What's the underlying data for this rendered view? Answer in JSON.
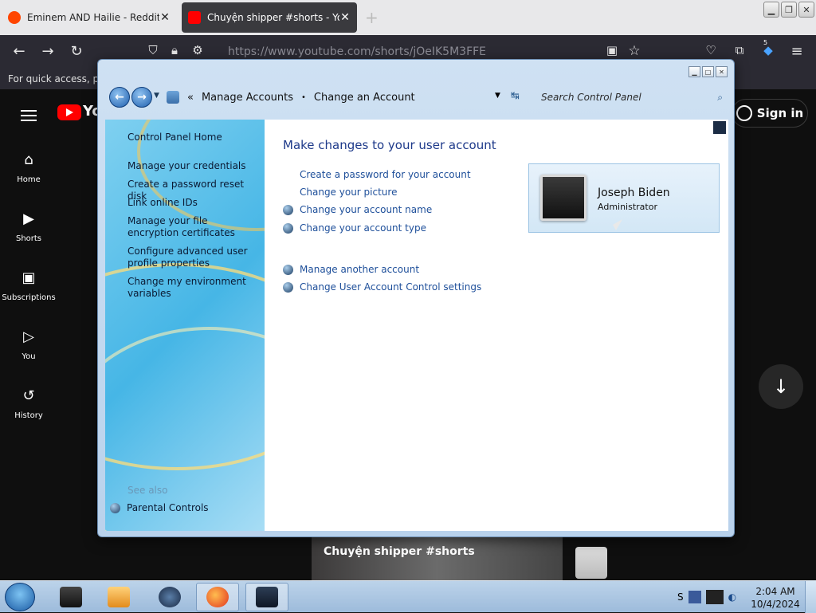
{
  "browser": {
    "tabs": [
      {
        "title": "Eminem AND Hailie - Reddit Se",
        "close": "✕"
      },
      {
        "title": "Chuyện shipper #shorts - YouTu",
        "close": "✕"
      }
    ],
    "new_tab": "+",
    "url": "https://www.youtube.com/shorts/jOeIK5M3FFE",
    "bookmarks_notice": "For quick access, plac",
    "extension_badge": "5"
  },
  "youtube": {
    "logo_text": "Yo",
    "sign_in": "Sign in",
    "nav": [
      {
        "label": "Home",
        "icon": "⌂"
      },
      {
        "label": "Shorts",
        "icon": "▶"
      },
      {
        "label": "Subscriptions",
        "icon": "▣"
      },
      {
        "label": "You",
        "icon": "▷"
      },
      {
        "label": "History",
        "icon": "↺"
      }
    ],
    "video_title": "Chuyện shipper #shorts",
    "scroll_down": "↓"
  },
  "control_panel": {
    "breadcrumb": {
      "prefix": "«",
      "item1": "Manage Accounts",
      "separator": "•",
      "item2": "Change an Account"
    },
    "search_placeholder": "Search Control Panel",
    "left_links": [
      "Control Panel Home",
      "Manage your credentials",
      "Create a password reset disk",
      "Link online IDs",
      "Manage your file encryption certificates",
      "Configure advanced user profile properties",
      "Change my environment variables"
    ],
    "see_also": "See also",
    "parental_controls": "Parental Controls",
    "main_title": "Make changes to your user account",
    "links": [
      "Create a password for your account",
      "Change your picture",
      "Change your account name",
      "Change your account type",
      "Manage another account",
      "Change User Account Control settings"
    ],
    "account": {
      "name": "Joseph Biden",
      "role": "Administrator"
    }
  },
  "taskbar": {
    "time": "2:04 AM",
    "date": "10/4/2024",
    "tray_text": "S"
  }
}
